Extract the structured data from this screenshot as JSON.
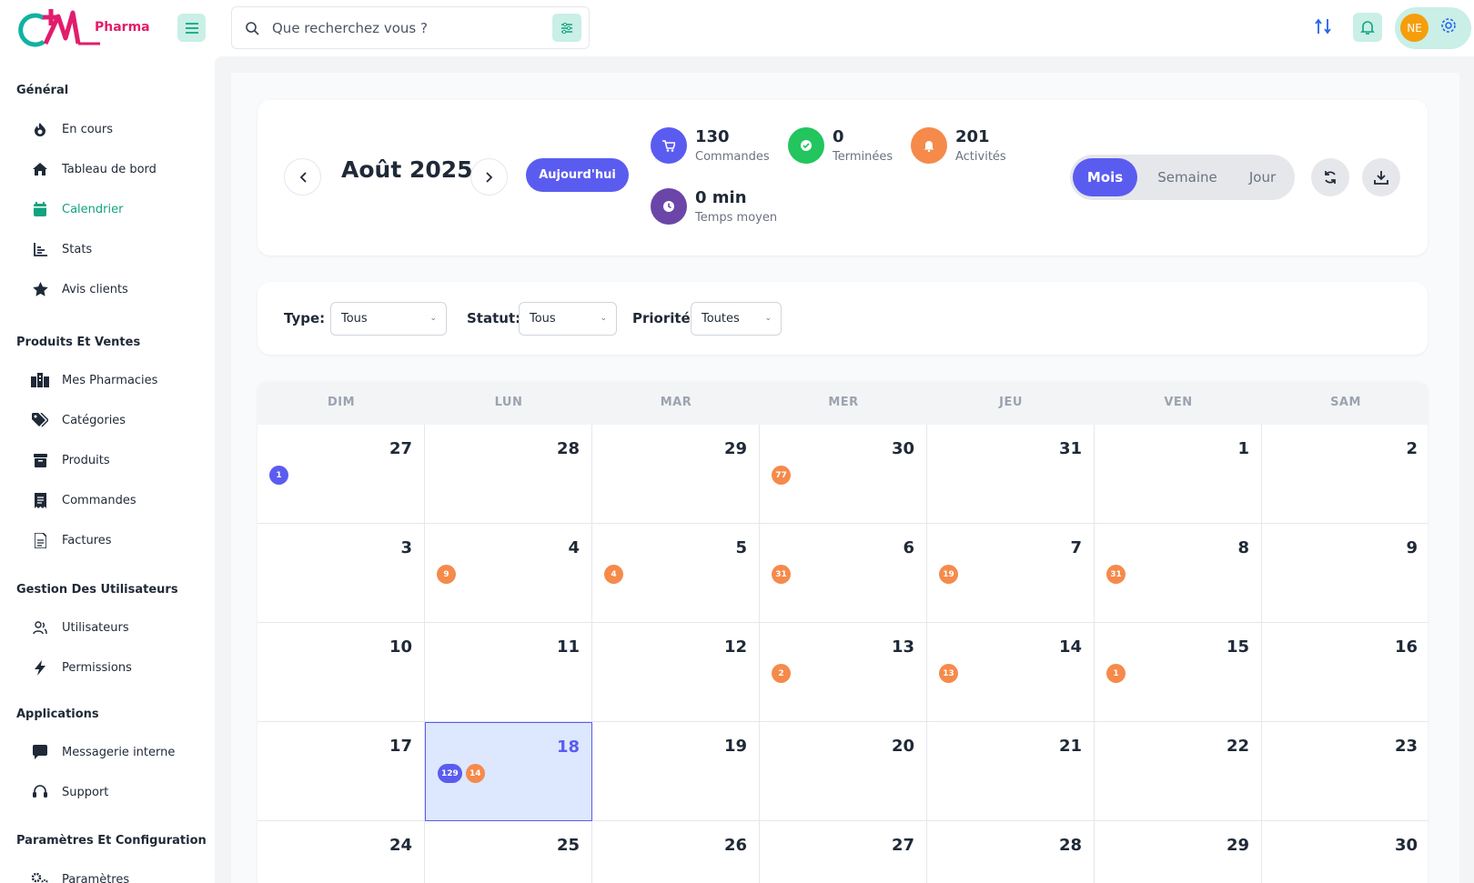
{
  "brand": {
    "logo_text": "Pharma",
    "primary": "#5a5cf0",
    "teal": "#10a37f",
    "orange": "#f58a4b"
  },
  "search": {
    "placeholder": "Que recherchez vous ?"
  },
  "user": {
    "initials": "NE"
  },
  "sidebar": {
    "sections": [
      {
        "title": "Général",
        "items": [
          {
            "label": "En cours",
            "icon": "fire-icon"
          },
          {
            "label": "Tableau de bord",
            "icon": "home-icon"
          },
          {
            "label": "Calendrier",
            "icon": "calendar-icon",
            "active": true
          },
          {
            "label": "Stats",
            "icon": "chart-icon"
          },
          {
            "label": "Avis clients",
            "icon": "star-icon"
          }
        ]
      },
      {
        "title": "Produits Et Ventes",
        "items": [
          {
            "label": "Mes Pharmacies",
            "icon": "building-icon"
          },
          {
            "label": "Catégories",
            "icon": "tags-icon"
          },
          {
            "label": "Produits",
            "icon": "box-icon"
          },
          {
            "label": "Commandes",
            "icon": "receipt-icon"
          },
          {
            "label": "Factures",
            "icon": "invoice-icon"
          }
        ]
      },
      {
        "title": "Gestion Des Utilisateurs",
        "items": [
          {
            "label": "Utilisateurs",
            "icon": "users-icon"
          },
          {
            "label": "Permissions",
            "icon": "bolt-icon"
          }
        ]
      },
      {
        "title": "Applications",
        "items": [
          {
            "label": "Messagerie interne",
            "icon": "message-icon"
          },
          {
            "label": "Support",
            "icon": "headset-icon"
          }
        ]
      },
      {
        "title": "Paramètres Et Configuration",
        "items": [
          {
            "label": "Paramètres",
            "icon": "cogs-icon"
          }
        ]
      }
    ]
  },
  "header": {
    "month": "Août 2025",
    "today_label": "Aujourd'hui",
    "stats": [
      {
        "value": "130",
        "label": "Commandes",
        "color": "#5a5cf0",
        "icon": "cart-icon"
      },
      {
        "value": "0",
        "label": "Terminées",
        "color": "#22c55e",
        "icon": "check-icon"
      },
      {
        "value": "201",
        "label": "Activités",
        "color": "#f58a4b",
        "icon": "bell-icon"
      },
      {
        "value": "0 min",
        "label": "Temps moyen",
        "color": "#6b46a8",
        "icon": "clock-icon"
      }
    ],
    "views": [
      "Mois",
      "Semaine",
      "Jour"
    ],
    "active_view": "Mois"
  },
  "filters": {
    "type_label": "Type:",
    "type_value": "Tous",
    "status_label": "Statut:",
    "status_value": "Tous",
    "priority_label": "Priorité:",
    "priority_value": "Toutes"
  },
  "calendar": {
    "weekdays": [
      "DIM",
      "LUN",
      "MAR",
      "MER",
      "JEU",
      "VEN",
      "SAM"
    ],
    "weeks": [
      [
        {
          "d": "27",
          "b": [
            [
              "1",
              "blue"
            ]
          ]
        },
        {
          "d": "28",
          "b": []
        },
        {
          "d": "29",
          "b": []
        },
        {
          "d": "30",
          "b": [
            [
              "77",
              "orange"
            ]
          ]
        },
        {
          "d": "31",
          "b": []
        },
        {
          "d": "1",
          "b": []
        },
        {
          "d": "2",
          "b": []
        }
      ],
      [
        {
          "d": "3",
          "b": []
        },
        {
          "d": "4",
          "b": [
            [
              "9",
              "orange"
            ]
          ]
        },
        {
          "d": "5",
          "b": [
            [
              "4",
              "orange"
            ]
          ]
        },
        {
          "d": "6",
          "b": [
            [
              "31",
              "orange"
            ]
          ]
        },
        {
          "d": "7",
          "b": [
            [
              "19",
              "orange"
            ]
          ]
        },
        {
          "d": "8",
          "b": [
            [
              "31",
              "orange"
            ]
          ]
        },
        {
          "d": "9",
          "b": []
        }
      ],
      [
        {
          "d": "10",
          "b": []
        },
        {
          "d": "11",
          "b": []
        },
        {
          "d": "12",
          "b": []
        },
        {
          "d": "13",
          "b": [
            [
              "2",
              "orange"
            ]
          ]
        },
        {
          "d": "14",
          "b": [
            [
              "13",
              "orange"
            ]
          ]
        },
        {
          "d": "15",
          "b": [
            [
              "1",
              "orange"
            ]
          ]
        },
        {
          "d": "16",
          "b": []
        }
      ],
      [
        {
          "d": "17",
          "b": []
        },
        {
          "d": "18",
          "b": [
            [
              "129",
              "blue"
            ],
            [
              "14",
              "orange"
            ]
          ],
          "today": true
        },
        {
          "d": "19",
          "b": []
        },
        {
          "d": "20",
          "b": []
        },
        {
          "d": "21",
          "b": []
        },
        {
          "d": "22",
          "b": []
        },
        {
          "d": "23",
          "b": []
        }
      ],
      [
        {
          "d": "24",
          "b": []
        },
        {
          "d": "25",
          "b": []
        },
        {
          "d": "26",
          "b": []
        },
        {
          "d": "27",
          "b": []
        },
        {
          "d": "28",
          "b": []
        },
        {
          "d": "29",
          "b": []
        },
        {
          "d": "30",
          "b": []
        }
      ]
    ]
  }
}
